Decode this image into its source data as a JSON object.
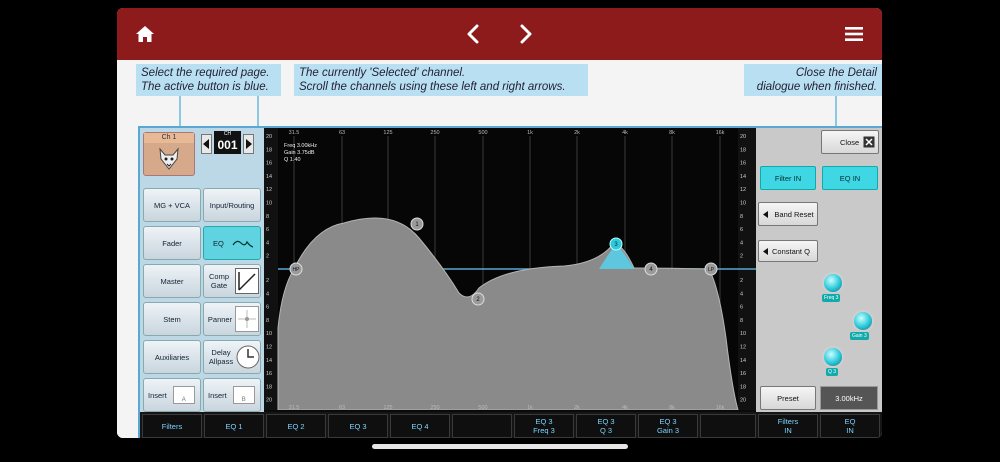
{
  "colors": {
    "topbar": "#8e1b1b",
    "accent_cyan": "#3fd7e3",
    "callout_bg": "#b9e0f2",
    "eq_curve": "#8a8a8a",
    "band_line": "#5aa7d2"
  },
  "topbar": {
    "home_icon": "home-icon",
    "prev_icon": "chevron-left-icon",
    "next_icon": "chevron-right-icon",
    "menu_icon": "menu-icon"
  },
  "callouts": {
    "page": {
      "line1": "Select the required page.",
      "line2": "The active button is blue."
    },
    "channel": {
      "line1": "The currently 'Selected' channel.",
      "line2": "Scroll the channels using these left and right arrows."
    },
    "close": {
      "line1": "Close the Detail",
      "line2": "dialogue when finished."
    }
  },
  "channel": {
    "name": "Ch 1",
    "ch_label": "CH",
    "number": "001"
  },
  "left_buttons": [
    {
      "label": "MG + VCA",
      "active": false
    },
    {
      "label": "Input/Routing",
      "active": false
    },
    {
      "label": "Fader",
      "active": false
    },
    {
      "label": "EQ",
      "active": true
    },
    {
      "label": "Master",
      "active": false
    },
    {
      "label": "Comp Gate",
      "active": false
    },
    {
      "label": "Stem",
      "active": false
    },
    {
      "label": "Panner",
      "active": false
    },
    {
      "label": "Auxiliaries",
      "active": false
    },
    {
      "label": "Delay Allpass",
      "active": false
    },
    {
      "label": "Insert",
      "active": false
    },
    {
      "label": "Insert",
      "active": false
    }
  ],
  "insert_badges": [
    "A",
    "B"
  ],
  "graph": {
    "freq_axis": [
      "31.5",
      "63",
      "125",
      "250",
      "500",
      "1k",
      "2k",
      "4k",
      "8k",
      "16k"
    ],
    "db_axis_top": [
      "20",
      "18",
      "16",
      "14",
      "12",
      "10",
      "8",
      "6",
      "4",
      "2"
    ],
    "db_axis_bottom": [
      "2",
      "4",
      "6",
      "8",
      "10",
      "12",
      "14",
      "16",
      "18",
      "20"
    ],
    "info": {
      "freq": "Freq 3.00kHz",
      "gain": "Gain 3.75dB",
      "q": "Q   1.40"
    },
    "markers": [
      "HP",
      "1",
      "2",
      "3",
      "4",
      "LP"
    ]
  },
  "right_panel": {
    "close": "Close",
    "filter_in": "Filter IN",
    "eq_in": "EQ IN",
    "band_reset": "Band Reset",
    "constant_q": "Constant Q",
    "knob_labels": [
      "Freq 3",
      "Gain 3",
      "Q 3"
    ],
    "preset": "Preset",
    "value_display": "3.00kHz"
  },
  "bottom_tabs": [
    {
      "line1": "Filters",
      "line2": ""
    },
    {
      "line1": "EQ 1",
      "line2": ""
    },
    {
      "line1": "EQ 2",
      "line2": ""
    },
    {
      "line1": "EQ 3",
      "line2": ""
    },
    {
      "line1": "EQ 4",
      "line2": ""
    },
    {
      "line1": "",
      "line2": ""
    },
    {
      "line1": "EQ 3",
      "line2": "Freq 3"
    },
    {
      "line1": "EQ 3",
      "line2": "Q 3"
    },
    {
      "line1": "EQ 3",
      "line2": "Gain 3"
    },
    {
      "line1": "",
      "line2": ""
    },
    {
      "line1": "Filters",
      "line2": "IN"
    },
    {
      "line1": "EQ",
      "line2": "IN"
    }
  ]
}
